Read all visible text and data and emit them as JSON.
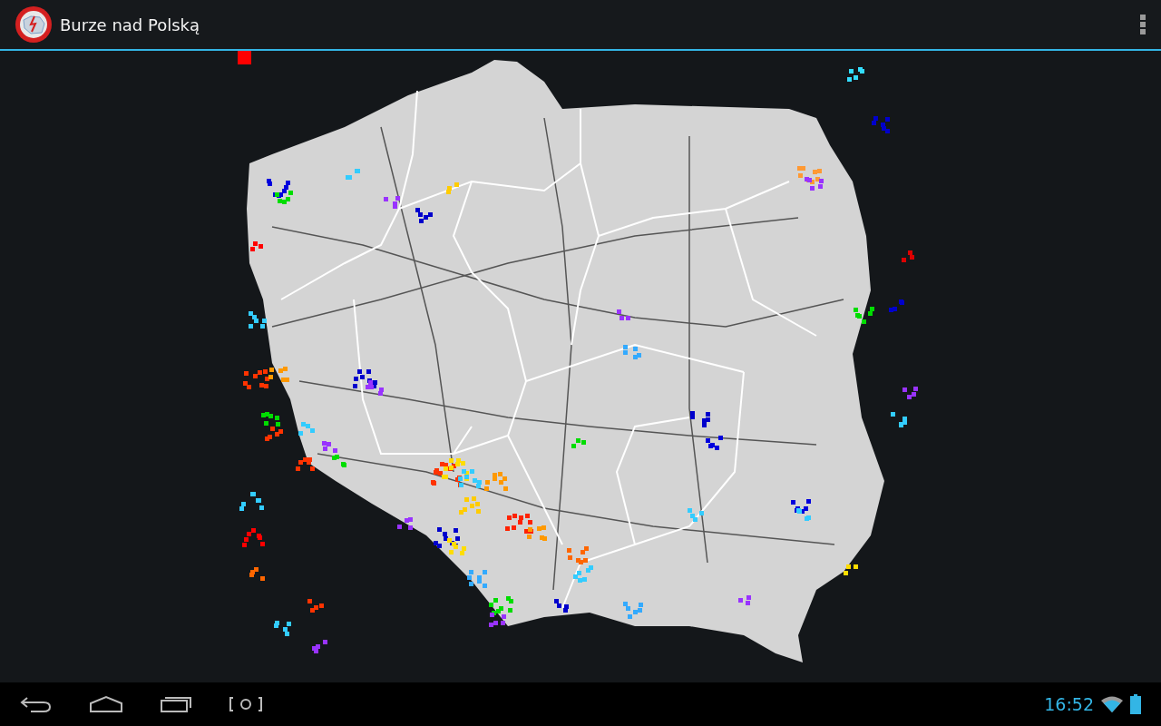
{
  "action_bar": {
    "title": "Burze nad Polską"
  },
  "status_bar": {
    "time": "16:52"
  }
}
